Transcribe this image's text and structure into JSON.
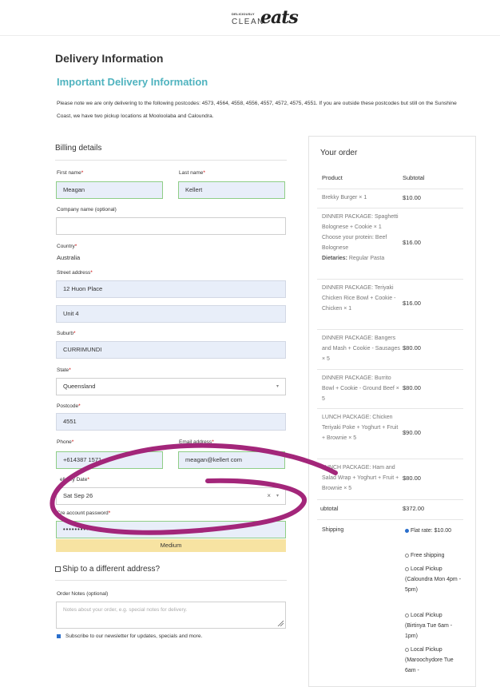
{
  "logo": {
    "small": "DELICIOUSLY",
    "clean": "CLEAN",
    "eats": "eats"
  },
  "page": {
    "title": "Delivery Information",
    "subtitle": "Important Delivery Information",
    "notice": "Please note we are only delivering to the following postcodes: 4573, 4564, 4558, 4556, 4557, 4572, 4575, 4551. If you are outside these postcodes but still on the Sunshine Coast, we have two pickup locations at Mooloolaba and Caloundra."
  },
  "billing": {
    "title": "Billing details",
    "first_name_label": "First name",
    "first_name": "Meagan",
    "last_name_label": "Last name",
    "last_name": "Kellert",
    "company_label": "Company name (optional)",
    "company": "",
    "country_label": "Country",
    "country": "Australia",
    "street_label": "Street address",
    "street1": "12 Huon Place",
    "street2": "Unit 4",
    "suburb_label": "Suburb",
    "suburb": "CURRIMUNDI",
    "state_label": "State",
    "state": "Queensland",
    "postcode_label": "Postcode",
    "postcode": "4551",
    "phone_label": "Phone",
    "phone": "+614387 1571",
    "email_label": "Email address",
    "email": "meagan@kellert          com",
    "delivery_date_label": "elivery Date",
    "delivery_date": "Sat Sep 26",
    "password_label": "Cre    account password",
    "password": "••••••••••",
    "strength": "Medium",
    "clear_icon": "×",
    "dropdown_arrow": "▾"
  },
  "shipping_diff": {
    "label": "Ship to a different address?"
  },
  "notes": {
    "label": "Order Notes (optional)",
    "placeholder": "Notes about your order, e.g. special notes for delivery."
  },
  "subscribe": {
    "label": "Subscribe to our newsletter for updates, specials and more."
  },
  "order": {
    "title": "Your order",
    "col_product": "Product",
    "col_subtotal": "Subtotal",
    "items": [
      {
        "name": "Brekky Burger × 1",
        "price": "$10.00"
      },
      {
        "name": "DINNER PACKAGE: Spaghetti Bolognese + Cookie × 1",
        "extra": "Choose your protein: Beef Bolognese",
        "extra2_label": "Dietaries:",
        "extra2_value": "Regular Pasta",
        "price": "$16.00"
      },
      {
        "name": "DINNER PACKAGE: Teriyaki Chicken Rice Bowl + Cookie - Chicken × 1",
        "price": "$16.00"
      },
      {
        "name": "DINNER PACKAGE: Bangers and Mash + Cookie - Sausages × 5",
        "price": "$80.00"
      },
      {
        "name": "DINNER PACKAGE: Burrito Bowl + Cookie - Ground Beef × 5",
        "price": "$80.00"
      },
      {
        "name": "LUNCH PACKAGE: Chicken Teriyaki Poke + Yoghurt + Fruit + Brownie × 5",
        "price": "$90.00"
      },
      {
        "name": "LUNCH PACKAGE: Ham and Salad Wrap + Yoghurt + Fruit + Brownie × 5",
        "price": "$80.00"
      }
    ],
    "subtotal_label": "ubtotal",
    "subtotal": "$372.00",
    "shipping_label": "Shipping",
    "shipping_options": [
      {
        "label": "Flat rate: $10.00",
        "selected": true
      },
      {
        "label": "Free shipping",
        "selected": false
      },
      {
        "label": "Local Pickup (Caloundra Mon 4pm - 5pm)",
        "selected": false
      },
      {
        "label": "Local Pickup (Birtinya Tue 6am - 1pm)",
        "selected": false
      },
      {
        "label": "Local Pickup (Maroochydore Tue 6am -",
        "selected": false
      }
    ]
  },
  "colors": {
    "accent": "#4fb3bf",
    "annotation": "#a3267a",
    "field_valid": "#8fce86",
    "strength": "#f7e3a2"
  }
}
